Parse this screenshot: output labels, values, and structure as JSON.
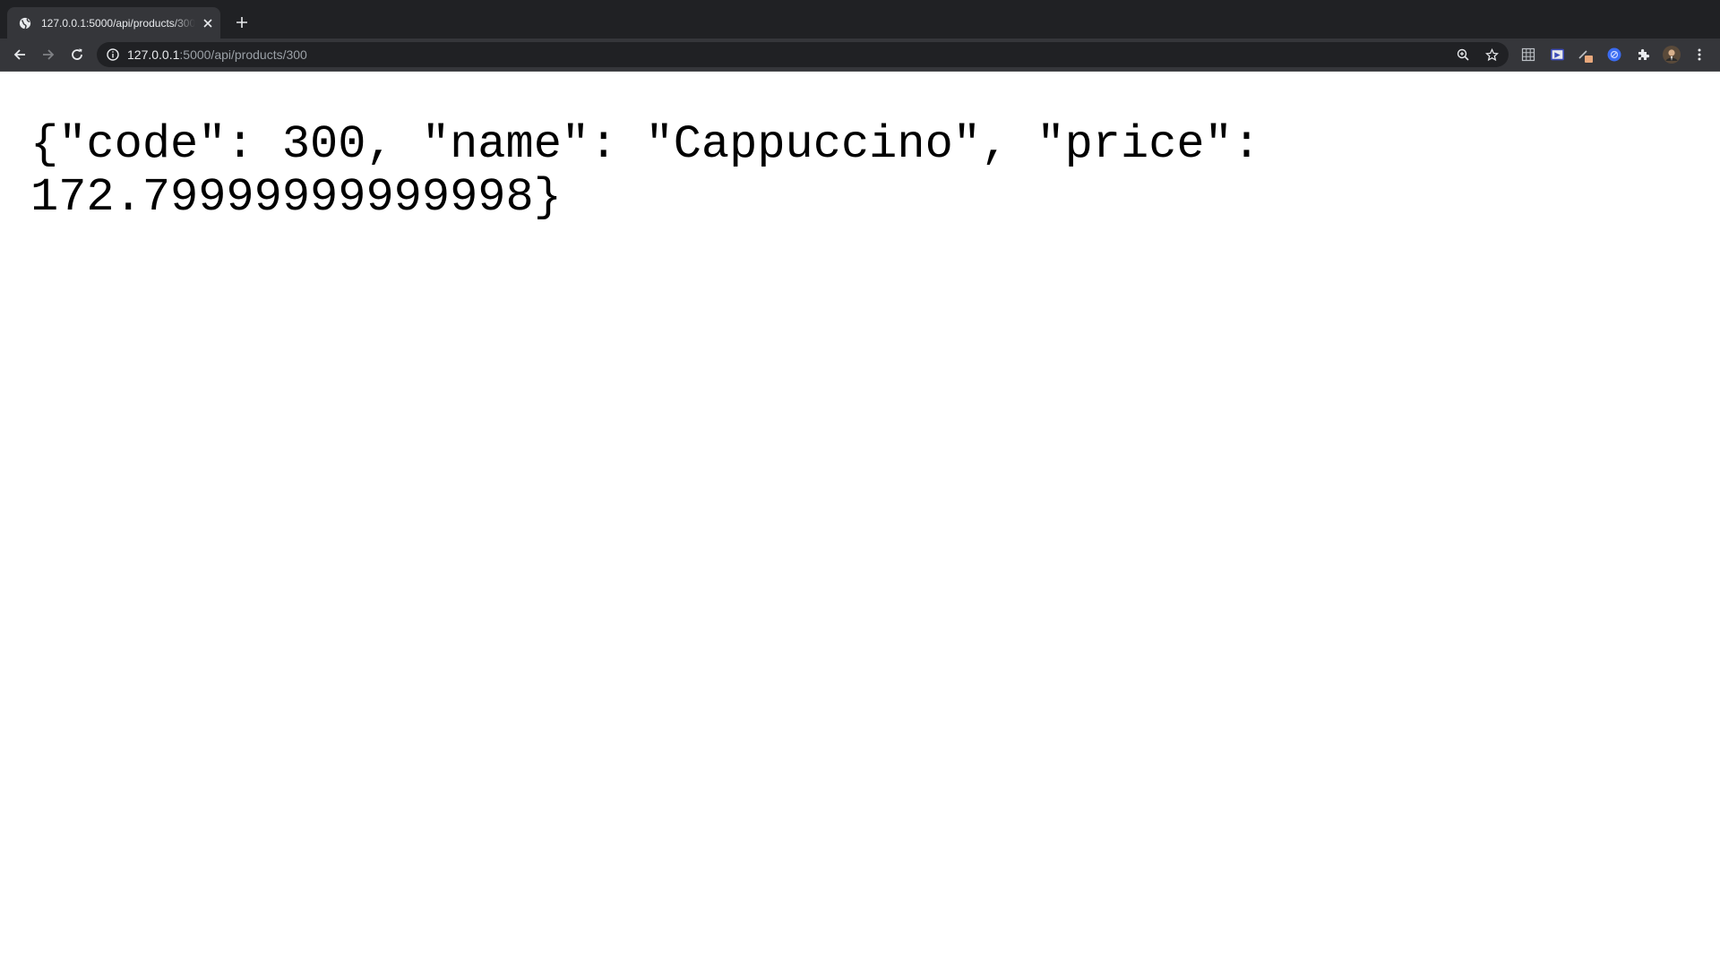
{
  "tab": {
    "title": "127.0.0.1:5000/api/products/300",
    "favicon": "globe-icon",
    "close_icon": "close-icon"
  },
  "new_tab_icon": "plus-icon",
  "toolbar": {
    "back_icon": "back-arrow-icon",
    "forward_icon": "forward-arrow-icon",
    "reload_icon": "reload-icon"
  },
  "omnibox": {
    "info_icon": "info-icon",
    "url_host": "127.0.0.1",
    "url_rest": ":5000/api/products/300",
    "zoom_icon": "zoom-icon",
    "bookmark_icon": "star-icon"
  },
  "extensions": [
    "grid-extension-icon",
    "screen-capture-extension-icon",
    "color-picker-extension-icon",
    "blue-circle-extension-icon",
    "puzzle-icon",
    "profile-avatar-icon",
    "kebab-menu-icon"
  ],
  "colors": {
    "tabstrip": "#202124",
    "toolbar": "#35363a",
    "omnibox": "#202124",
    "page_bg": "#ffffff",
    "text": "#000000"
  },
  "page": {
    "json_body": "{\"code\": 300, \"name\": \"Cappuccino\", \"price\": 172.79999999999998}"
  }
}
